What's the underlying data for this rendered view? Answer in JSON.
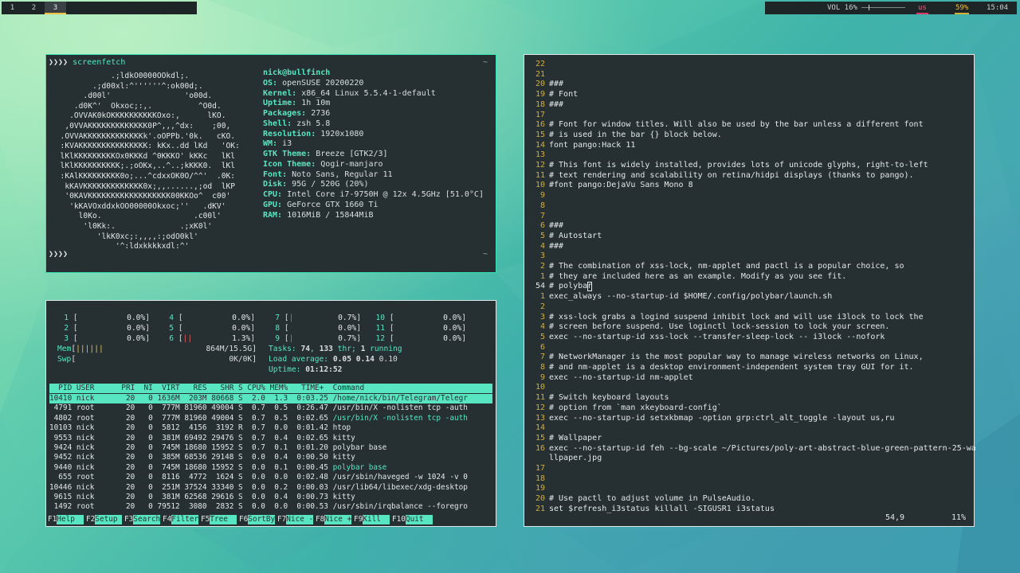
{
  "topbar": {
    "workspaces": [
      {
        "label": "1",
        "active": false
      },
      {
        "label": "2",
        "active": false
      },
      {
        "label": "3",
        "active": true
      }
    ],
    "volume": "VOL 16%",
    "volume_fraction": 0.16,
    "keyboard_layout": "us",
    "battery": "59%",
    "clock": "15:04"
  },
  "screenfetch": {
    "prompt": "❯❯❯❯",
    "command": "screenfetch",
    "tilde": "~",
    "logo": [
      "             .;ldkO0000OOkdl;.",
      "         .;d00xl:^''''''^:ok00d;.",
      "       .d00l'                'o00d.",
      "     .d0K^'  Okxoc;:,.          ^O0d.",
      "    .OVVAK0kOKKKKKKKKKKOxo:,      lKO.",
      "   ,0VVAKKKKKKKKKKKKK0P^,,,^dx:    ;00,",
      "  .OVVAKKKKKKKKKKKKKk'.oOPPb.'0k.   cKO.",
      "  :KVAKKKKKKKKKKKKKKK: kKx..dd lKd   'OK:",
      "  lKlKKKKKKKKKOx0KKKd ^0KKKO' kKKc   lKl",
      "  lKlKKKKKKKKKK;.;oOKx,..^..;kKKK0.  lKl",
      "  :KAlKKKKKKKKK0o;...^cdxxOK0O/^^'  .0K:",
      "   kKAVKKKKKKKKKKKKK0x;,,......,;od  lKP",
      "   '0KAVKKKKKKKKKKKKKKKKKK00KKOo^  c00'",
      "    'kKAVOxddxkOO00000Okxoc;''   .dKV'",
      "      l0Ko.                    .c00l'",
      "       'l0Kk:.              .;xK0l'",
      "          'lkK0xc;:,,,,:;odO0kl'",
      "              '^:ldxkkkkxdl:^'"
    ],
    "user_host": "nick@bullfinch",
    "info": [
      {
        "key": "OS:",
        "value": "openSUSE 20200220"
      },
      {
        "key": "Kernel:",
        "value": "x86_64 Linux 5.5.4-1-default"
      },
      {
        "key": "Uptime:",
        "value": "1h 10m"
      },
      {
        "key": "Packages:",
        "value": "2736"
      },
      {
        "key": "Shell:",
        "value": "zsh 5.8"
      },
      {
        "key": "Resolution:",
        "value": "1920x1080"
      },
      {
        "key": "WM:",
        "value": "i3"
      },
      {
        "key": "GTK Theme:",
        "value": "Breeze [GTK2/3]"
      },
      {
        "key": "Icon Theme:",
        "value": "Qogir-manjaro"
      },
      {
        "key": "Font:",
        "value": "Noto Sans, Regular 11"
      },
      {
        "key": "Disk:",
        "value": "95G / 520G (20%)"
      },
      {
        "key": "CPU:",
        "value": "Intel Core i7-9750H @ 12x 4.5GHz [51.0°C]"
      },
      {
        "key": "GPU:",
        "value": "GeForce GTX 1660 Ti"
      },
      {
        "key": "RAM:",
        "value": "1016MiB / 15844MiB"
      }
    ]
  },
  "htop": {
    "cpus": [
      {
        "n": "1",
        "bar": "",
        "pct": "0.0%"
      },
      {
        "n": "2",
        "bar": "",
        "pct": "0.0%"
      },
      {
        "n": "3",
        "bar": "",
        "pct": "0.0%"
      },
      {
        "n": "4",
        "bar": "",
        "pct": "0.0%"
      },
      {
        "n": "5",
        "bar": "",
        "pct": "0.0%"
      },
      {
        "n": "6",
        "bar": "||",
        "pct": "1.3%"
      },
      {
        "n": "7",
        "bar": "|",
        "pct": "0.7%"
      },
      {
        "n": "8",
        "bar": "",
        "pct": "0.0%"
      },
      {
        "n": "9",
        "bar": "|",
        "pct": "0.7%"
      },
      {
        "n": "10",
        "bar": "",
        "pct": "0.0%"
      },
      {
        "n": "11",
        "bar": "",
        "pct": "0.0%"
      },
      {
        "n": "12",
        "bar": "",
        "pct": "0.0%"
      }
    ],
    "mem_label": "Mem",
    "mem_bar": "||||||",
    "mem_value": "864M/15.5G",
    "swp_label": "Swp",
    "swp_value": "0K/0K",
    "tasks_label": "Tasks:",
    "tasks_count": "74",
    "tasks_threads": "133",
    "tasks_thr_text": "thr;",
    "tasks_running": "1",
    "tasks_running_text": "running",
    "load_label": "Load average:",
    "load_1": "0.05",
    "load_5": "0.14",
    "load_15": "0.10",
    "uptime_label": "Uptime:",
    "uptime_value": "01:12:52",
    "header": "  PID USER      PRI  NI  VIRT   RES   SHR S CPU% MEM%   TIME+  Command",
    "rows": [
      {
        "text": "10410 nick       20   0 1636M  203M 80668 S  2.0  1.3  0:03.25 ",
        "cmd": "/home/nick/bin/Telegram/Telegr",
        "selected": true
      },
      {
        "text": " 4791 root       20   0  777M 81960 49004 S  0.7  0.5  0:26.47 ",
        "cmd": "/usr/bin/X -nolisten tcp -auth",
        "selected": false
      },
      {
        "text": " 4802 root       20   0  777M 81960 49004 S  0.7  0.5  0:02.65 ",
        "cmd": "/usr/bin/X -nolisten tcp -auth",
        "selected": false,
        "path": true
      },
      {
        "text": "10103 nick       20   0  5812  4156  3192 R  0.7  0.0  0:01.42 ",
        "cmd": "htop",
        "selected": false
      },
      {
        "text": " 9553 nick       20   0  381M 69492 29476 S  0.7  0.4  0:02.65 ",
        "cmd": "kitty",
        "selected": false
      },
      {
        "text": " 9424 nick       20   0  745M 18680 15952 S  0.7  0.1  0:01.20 ",
        "cmd": "polybar base",
        "selected": false
      },
      {
        "text": " 9452 nick       20   0  385M 68536 29148 S  0.0  0.4  0:00.50 ",
        "cmd": "kitty",
        "selected": false
      },
      {
        "text": " 9440 nick       20   0  745M 18680 15952 S  0.0  0.1  0:00.45 ",
        "cmd": "polybar base",
        "selected": false,
        "path": true
      },
      {
        "text": "  655 root       20   0  8116  4772  1624 S  0.0  0.0  0:02.48 ",
        "cmd": "/usr/sbin/haveged -w 1024 -v 0",
        "selected": false
      },
      {
        "text": "10446 nick       20   0  251M 37524 33340 S  0.0  0.2  0:00.03 ",
        "cmd": "/usr/lib64/libexec/xdg-desktop",
        "selected": false
      },
      {
        "text": " 9615 nick       20   0  381M 62568 29616 S  0.0  0.4  0:00.73 ",
        "cmd": "kitty",
        "selected": false
      },
      {
        "text": " 1492 root       20   0 79512  3080  2832 S  0.0  0.0  0:00.53 ",
        "cmd": "/usr/sbin/irqbalance --foregro",
        "selected": false
      }
    ],
    "fkeys": [
      {
        "key": "F1",
        "label": "Help  "
      },
      {
        "key": "F2",
        "label": "Setup "
      },
      {
        "key": "F3",
        "label": "Search"
      },
      {
        "key": "F4",
        "label": "Filter"
      },
      {
        "key": "F5",
        "label": "Tree  "
      },
      {
        "key": "F6",
        "label": "SortBy"
      },
      {
        "key": "F7",
        "label": "Nice -"
      },
      {
        "key": "F8",
        "label": "Nice +"
      },
      {
        "key": "F9",
        "label": "Kill  "
      },
      {
        "key": "F10",
        "label": "Quit  "
      }
    ]
  },
  "vim": {
    "lines": [
      {
        "n": "22",
        "t": ""
      },
      {
        "n": "21",
        "t": ""
      },
      {
        "n": "20",
        "t": "###"
      },
      {
        "n": "19",
        "t": "# Font"
      },
      {
        "n": "18",
        "t": "###"
      },
      {
        "n": "17",
        "t": ""
      },
      {
        "n": "16",
        "t": "# Font for window titles. Will also be used by the bar unless a different font"
      },
      {
        "n": "15",
        "t": "# is used in the bar {} block below."
      },
      {
        "n": "14",
        "t": "font pango:Hack 11"
      },
      {
        "n": "13",
        "t": ""
      },
      {
        "n": "12",
        "t": "# This font is widely installed, provides lots of unicode glyphs, right-to-left"
      },
      {
        "n": "11",
        "t": "# text rendering and scalability on retina/hidpi displays (thanks to pango)."
      },
      {
        "n": "10",
        "t": "#font pango:DejaVu Sans Mono 8"
      },
      {
        "n": "9",
        "t": ""
      },
      {
        "n": "8",
        "t": ""
      },
      {
        "n": "7",
        "t": ""
      },
      {
        "n": "6",
        "t": "###"
      },
      {
        "n": "5",
        "t": "# Autostart"
      },
      {
        "n": "4",
        "t": "###"
      },
      {
        "n": "3",
        "t": ""
      },
      {
        "n": "2",
        "t": "# The combination of xss-lock, nm-applet and pactl is a popular choice, so"
      },
      {
        "n": "1",
        "t": "# they are included here as an example. Modify as you see fit."
      },
      {
        "n": "54",
        "t": "# polybar",
        "current": true
      },
      {
        "n": "1",
        "t": "exec_always --no-startup-id $HOME/.config/polybar/launch.sh"
      },
      {
        "n": "2",
        "t": ""
      },
      {
        "n": "3",
        "t": "# xss-lock grabs a logind suspend inhibit lock and will use i3lock to lock the"
      },
      {
        "n": "4",
        "t": "# screen before suspend. Use loginctl lock-session to lock your screen."
      },
      {
        "n": "5",
        "t": "exec --no-startup-id xss-lock --transfer-sleep-lock -- i3lock --nofork"
      },
      {
        "n": "6",
        "t": ""
      },
      {
        "n": "7",
        "t": "# NetworkManager is the most popular way to manage wireless networks on Linux,"
      },
      {
        "n": "8",
        "t": "# and nm-applet is a desktop environment-independent system tray GUI for it."
      },
      {
        "n": "9",
        "t": "exec --no-startup-id nm-applet"
      },
      {
        "n": "10",
        "t": ""
      },
      {
        "n": "11",
        "t": "# Switch keyboard layouts"
      },
      {
        "n": "12",
        "t": "# option from `man xkeyboard-config`"
      },
      {
        "n": "13",
        "t": "exec --no-startup-id setxkbmap -option grp:ctrl_alt_toggle -layout us,ru"
      },
      {
        "n": "14",
        "t": ""
      },
      {
        "n": "15",
        "t": "# Wallpaper"
      },
      {
        "n": "16",
        "t": "exec --no-startup-id feh --bg-scale ~/Pictures/poly-art-abstract-blue-green-pattern-25-wa"
      },
      {
        "n": "",
        "t": "llpaper.jpg"
      },
      {
        "n": "17",
        "t": ""
      },
      {
        "n": "18",
        "t": ""
      },
      {
        "n": "19",
        "t": ""
      },
      {
        "n": "20",
        "t": "# Use pactl to adjust volume in PulseAudio."
      },
      {
        "n": "21",
        "t": "set $refresh_i3status killall -SIGUSR1 i3status"
      }
    ],
    "cursor_pos": "54,9",
    "scroll_pct": "11%"
  }
}
